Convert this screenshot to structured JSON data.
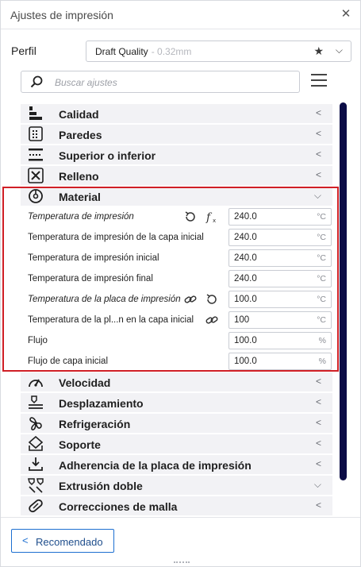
{
  "window": {
    "title": "Ajustes de impresión",
    "close_glyph": "✕"
  },
  "profile": {
    "label": "Perfil",
    "name": "Draft Quality",
    "suffix": "- 0.32mm",
    "star_glyph": "★",
    "chevron_glyph": "⌵"
  },
  "search": {
    "placeholder": "Buscar ajustes"
  },
  "categories_top": [
    {
      "id": "calidad",
      "label": "Calidad",
      "icon": "quality-icon",
      "arrow": "<"
    },
    {
      "id": "paredes",
      "label": "Paredes",
      "icon": "walls-icon",
      "arrow": "<"
    },
    {
      "id": "superior",
      "label": "Superior o inferior",
      "icon": "top-bottom-icon",
      "arrow": "<"
    },
    {
      "id": "relleno",
      "label": "Relleno",
      "icon": "infill-icon",
      "arrow": "<"
    },
    {
      "id": "material",
      "label": "Material",
      "icon": "material-icon",
      "arrow": "⌵"
    }
  ],
  "material_settings": [
    {
      "label": "Temperatura de impresión",
      "italic": true,
      "value": "240.0",
      "unit": "°C",
      "actions": [
        "reset-icon",
        "function-icon"
      ]
    },
    {
      "label": "Temperatura de impresión de la capa inicial",
      "italic": false,
      "value": "240.0",
      "unit": "°C",
      "actions": []
    },
    {
      "label": "Temperatura de impresión inicial",
      "italic": false,
      "value": "240.0",
      "unit": "°C",
      "actions": []
    },
    {
      "label": "Temperatura de impresión final",
      "italic": false,
      "value": "240.0",
      "unit": "°C",
      "actions": []
    },
    {
      "label": "Temperatura de la placa de impresión",
      "italic": true,
      "value": "100.0",
      "unit": "°C",
      "actions": [
        "link-icon",
        "reset-icon"
      ]
    },
    {
      "label": "Temperatura de la pl...n en la capa inicial",
      "italic": false,
      "value": "100",
      "unit": "°C",
      "actions": [
        "link-icon"
      ]
    },
    {
      "label": "Flujo",
      "italic": false,
      "value": "100.0",
      "unit": "%",
      "actions": []
    },
    {
      "label": "Flujo de capa inicial",
      "italic": false,
      "value": "100.0",
      "unit": "%",
      "actions": []
    }
  ],
  "categories_bottom": [
    {
      "id": "velocidad",
      "label": "Velocidad",
      "icon": "speed-icon",
      "arrow": "<"
    },
    {
      "id": "desplazamiento",
      "label": "Desplazamiento",
      "icon": "travel-icon",
      "arrow": "<"
    },
    {
      "id": "refrigeracion",
      "label": "Refrigeración",
      "icon": "fan-icon",
      "arrow": "<"
    },
    {
      "id": "soporte",
      "label": "Soporte",
      "icon": "support-icon",
      "arrow": "<"
    },
    {
      "id": "adherencia",
      "label": "Adherencia de la placa de impresión",
      "icon": "adhesion-icon",
      "arrow": "<"
    },
    {
      "id": "extrusion",
      "label": "Extrusión doble",
      "icon": "dual-extrusion-icon",
      "arrow": "⌵"
    },
    {
      "id": "correcciones",
      "label": "Correcciones de malla",
      "icon": "mesh-fix-icon",
      "arrow": "<"
    }
  ],
  "footer": {
    "recommended_label": "Recomendado",
    "chevron_glyph": "<"
  },
  "colors": {
    "accent": "#1d6fd1",
    "highlight": "#d01f26",
    "scrollbar": "#0b0c46",
    "category_bg": "#f2f2f5"
  }
}
